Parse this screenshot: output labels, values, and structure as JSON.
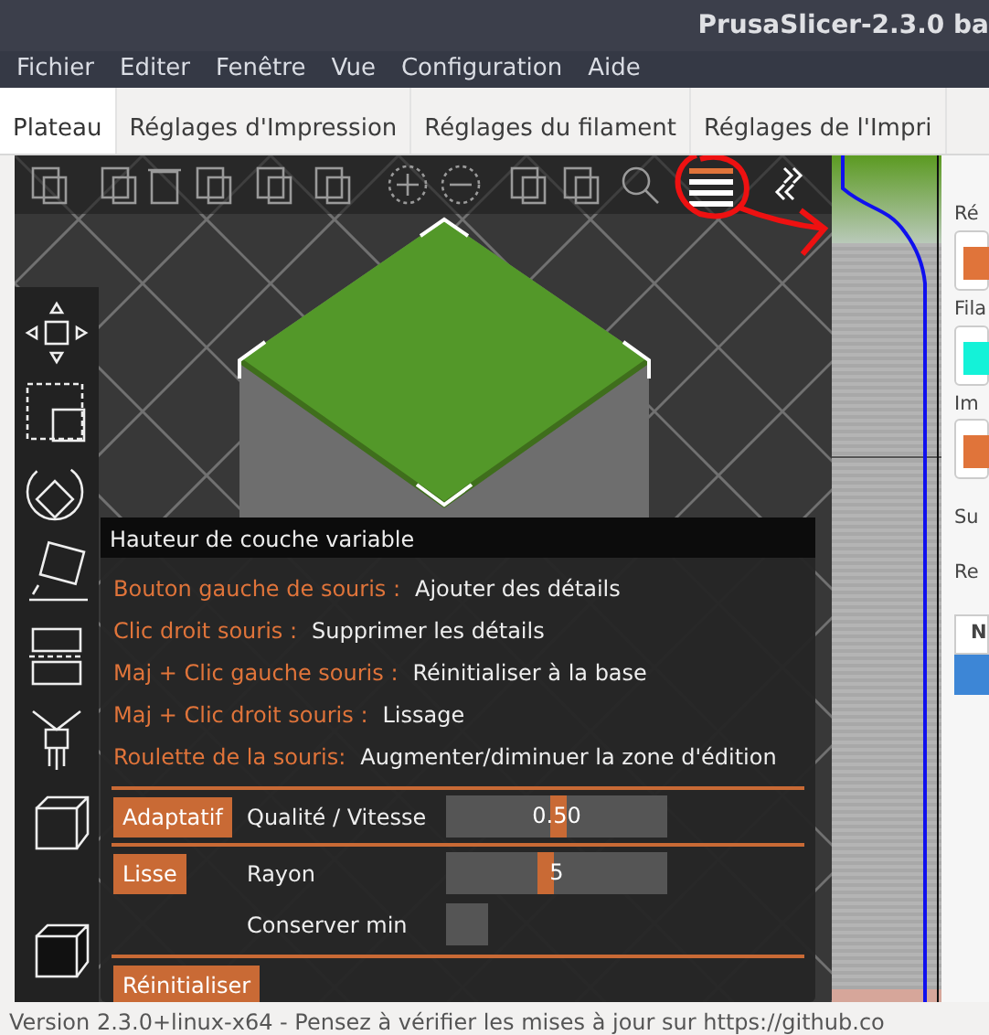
{
  "window": {
    "title": "PrusaSlicer-2.3.0 ba"
  },
  "menu": [
    "Fichier",
    "Editer",
    "Fenêtre",
    "Vue",
    "Configuration",
    "Aide"
  ],
  "tabs": [
    {
      "label": "Plateau",
      "selected": true
    },
    {
      "label": "Réglages d'Impression",
      "selected": false
    },
    {
      "label": "Réglages du filament",
      "selected": false
    },
    {
      "label": "Réglages de l'Impri",
      "selected": false
    }
  ],
  "layer_panel": {
    "title": "Hauteur de couche variable",
    "hints": [
      {
        "key": "Bouton gauche de souris :",
        "action": "Ajouter des détails"
      },
      {
        "key": "Clic droit souris :",
        "action": "Supprimer les détails"
      },
      {
        "key": "Maj + Clic gauche souris :",
        "action": "Réinitialiser à la base"
      },
      {
        "key": "Maj + Clic droit souris :",
        "action": "Lissage"
      },
      {
        "key": "Roulette de la souris:",
        "action": "Augmenter/diminuer la zone d'édition"
      }
    ],
    "adaptive": {
      "button": "Adaptatif",
      "label": "Qualité / Vitesse",
      "value": "0.50",
      "level": 0.5
    },
    "smooth": {
      "button": "Lisse",
      "label": "Rayon",
      "value": "5",
      "level": 0.45,
      "checkbox_label": "Conserver min",
      "checked": false
    },
    "reset_button": "Réinitialiser"
  },
  "sidebar": {
    "labels": [
      "Ré",
      "Fila",
      "Im",
      "Su",
      "Re"
    ],
    "table_header": "N"
  },
  "status_bar": "Version 2.3.0+linux-x64 - Pensez à vérifier les mises à jour sur https://github.co"
}
